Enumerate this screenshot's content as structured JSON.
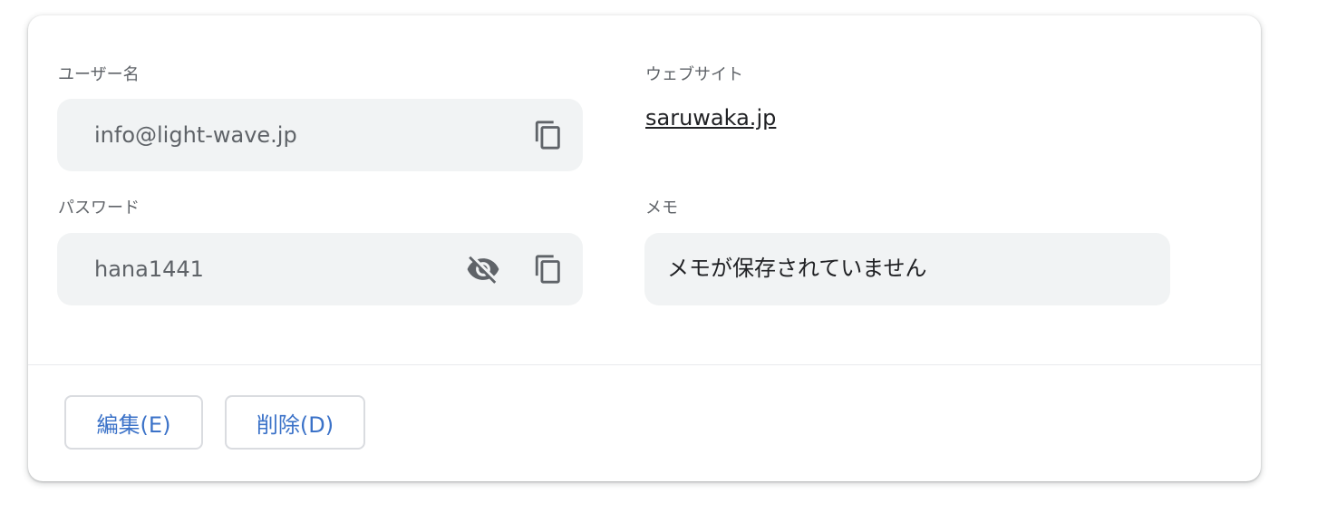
{
  "username": {
    "label": "ユーザー名",
    "value": "info@light-wave.jp",
    "copy_icon": "copy-icon"
  },
  "website": {
    "label": "ウェブサイト",
    "value": "saruwaka.jp"
  },
  "password": {
    "label": "パスワード",
    "value": "hana1441",
    "visibility_icon": "eye-off-icon",
    "copy_icon": "copy-icon"
  },
  "memo": {
    "label": "メモ",
    "value": "メモが保存されていません"
  },
  "actions": {
    "edit_label": "編集(E)",
    "delete_label": "削除(D)"
  },
  "colors": {
    "accent": "#3b72c8",
    "field_bg": "#f1f3f4",
    "label_text": "#5f6368"
  }
}
